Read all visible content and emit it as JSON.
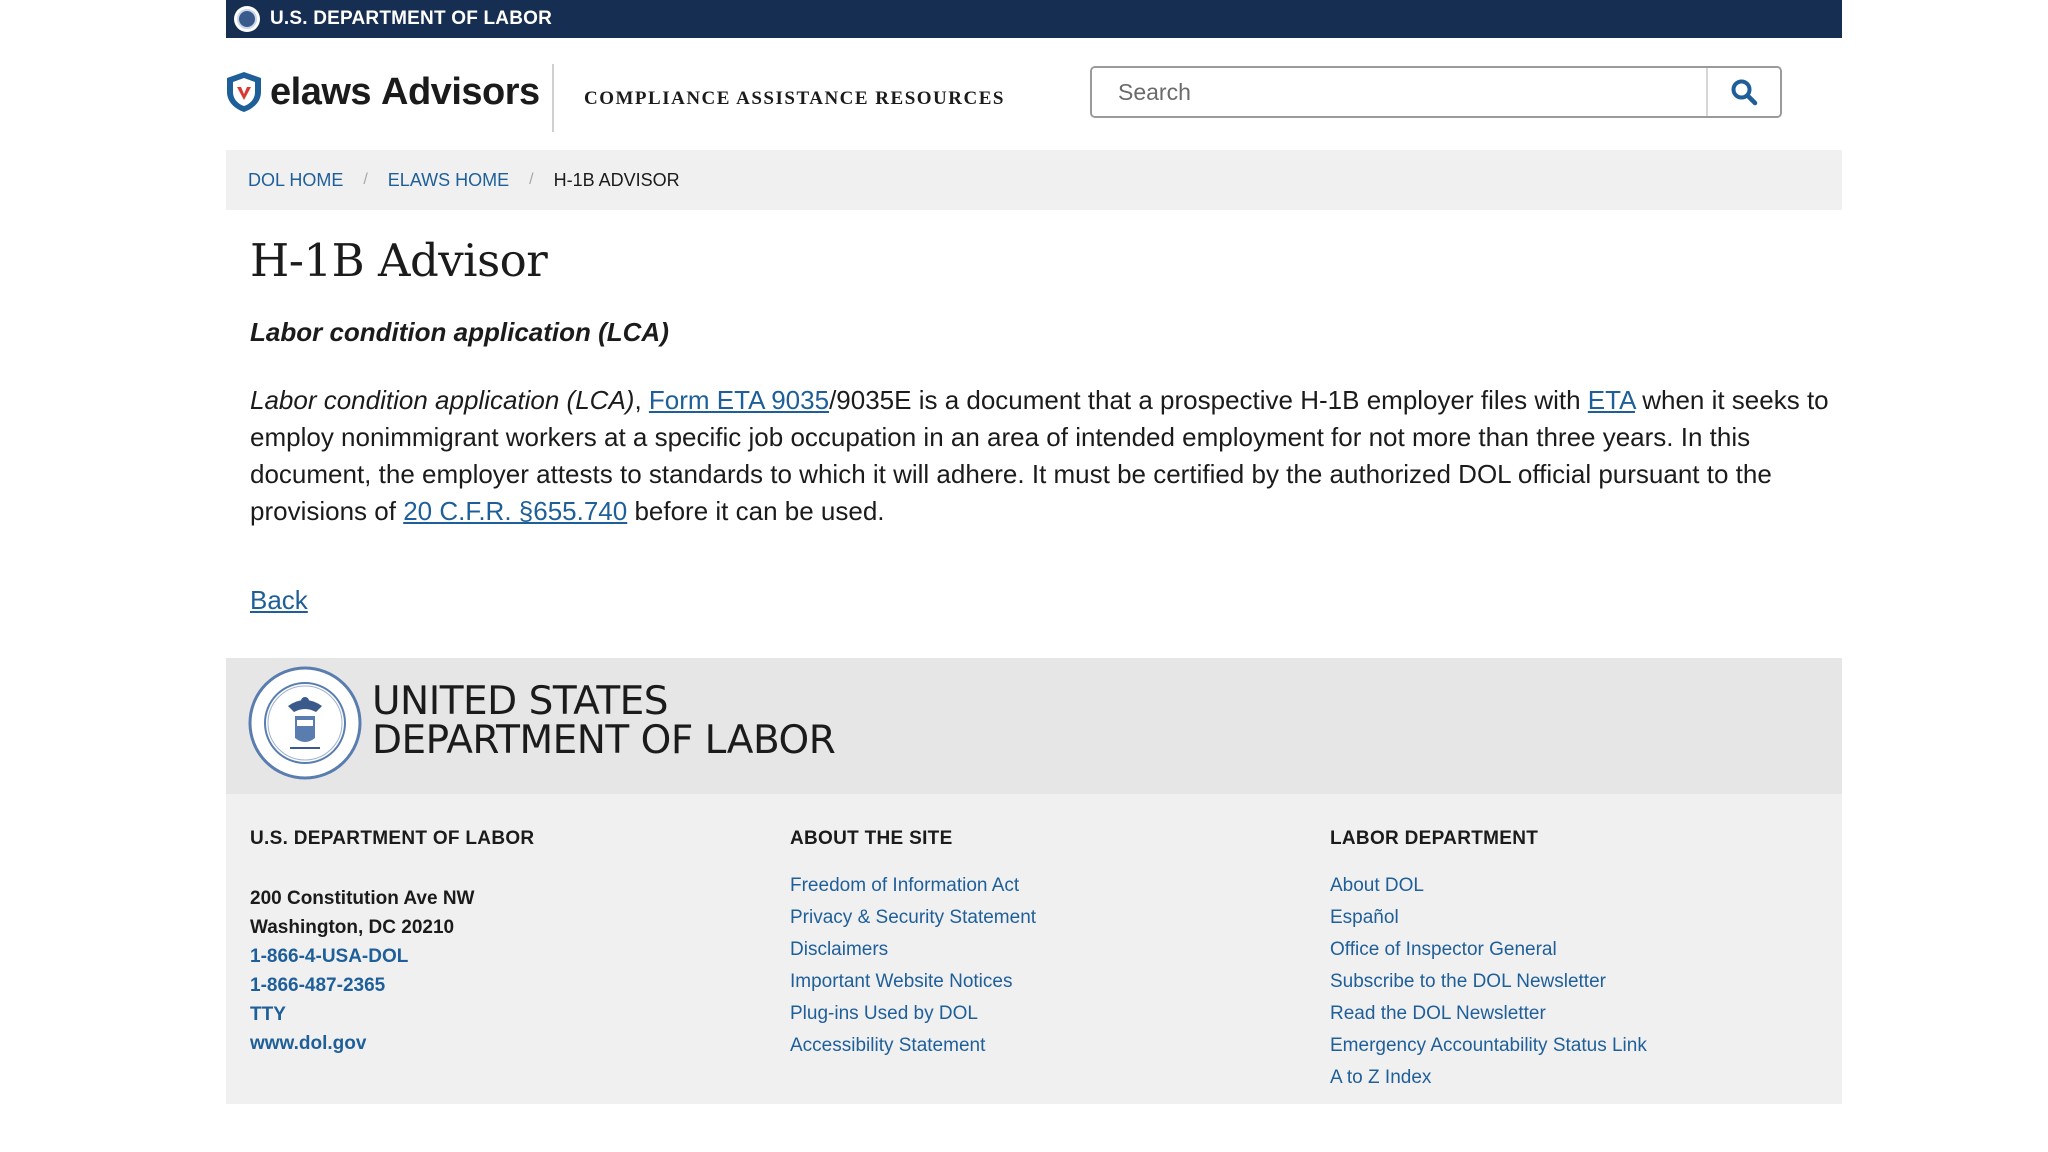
{
  "topbar": {
    "label": "U.S. DEPARTMENT OF LABOR"
  },
  "header": {
    "logo_main": "elaws",
    "logo_sub": "Advisors",
    "tagline": "COMPLIANCE ASSISTANCE RESOURCES",
    "search_placeholder": "Search",
    "search_value": ""
  },
  "breadcrumb": {
    "items": [
      "DOL HOME",
      "ELAWS HOME",
      "H-1B ADVISOR"
    ],
    "separator": "/"
  },
  "main": {
    "title": "H-1B Advisor",
    "subheading": "Labor condition application (LCA)",
    "para": {
      "term": "Labor condition application (LCA)",
      "comma": ", ",
      "link_form": "Form ETA 9035",
      "text1": "/9035E is a document that a prospective H-1B employer files with ",
      "link_eta": "ETA",
      "text2": " when it seeks to employ nonimmigrant workers at a specific job occupation in an area of intended employment for not more than three years. In this document, the employer attests to standards to which it will adhere. It must be certified by the authorized DOL official pursuant to the provisions of ",
      "link_cfr": "20 C.F.R. §655.740",
      "text3": " before it can be used."
    },
    "back_link": "Back"
  },
  "footer": {
    "dol_line1": "UNITED STATES",
    "dol_line2": "DEPARTMENT OF LABOR",
    "col1": {
      "heading": "U.S. DEPARTMENT OF LABOR",
      "address1": "200 Constitution Ave NW",
      "address2": "Washington, DC 20210",
      "phone1": "1-866-4-USA-DOL",
      "phone2": "1-866-487-2365",
      "tty": "TTY",
      "website": "www.dol.gov"
    },
    "col2": {
      "heading": "ABOUT THE SITE",
      "links": [
        "Freedom of Information Act",
        "Privacy & Security Statement",
        "Disclaimers",
        "Important Website Notices",
        "Plug-ins Used by DOL",
        "Accessibility Statement"
      ]
    },
    "col3": {
      "heading": "LABOR DEPARTMENT",
      "links": [
        "About DOL",
        "Español",
        "Office of Inspector General",
        "Subscribe to the DOL Newsletter",
        "Read the DOL Newsletter",
        "Emergency Accountability Status Link",
        "A to Z Index"
      ]
    }
  },
  "colors": {
    "topbar_bg": "#162e51",
    "link": "#1f5f99",
    "breadcrumb_bg": "#f0f0f0",
    "footer_brand_bg": "#e6e6e6",
    "footer_bg": "#f0f0f0",
    "shield_red": "#d83933",
    "shield_blue": "#1f5f99"
  }
}
